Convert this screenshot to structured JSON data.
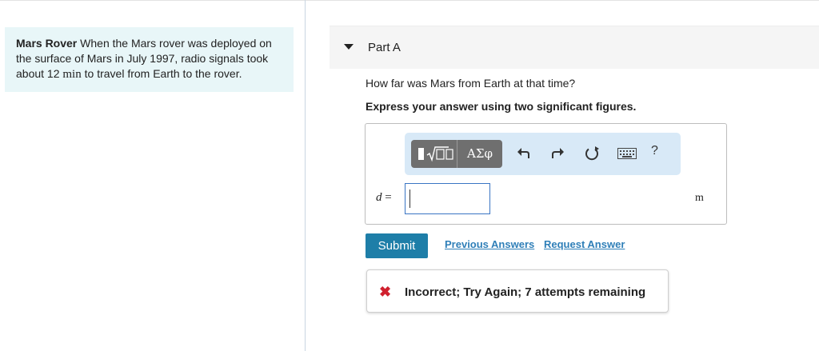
{
  "problem": {
    "title": "Mars Rover",
    "text_before": " When the Mars rover was deployed on the surface of Mars in July 1997, radio signals took about 12 ",
    "unit_inline": "min",
    "text_after": " to travel from Earth to the rover."
  },
  "part": {
    "title": "Part A",
    "question": "How far was Mars from Earth at that time?",
    "instruction": "Express your answer using two significant figures."
  },
  "toolbar": {
    "templates_icon": "templates-icon",
    "greek_label": "ΑΣφ",
    "undo_icon": "undo-icon",
    "redo_icon": "redo-icon",
    "reset_icon": "reset-icon",
    "keyboard_icon": "keyboard-icon",
    "help_label": "?"
  },
  "answer": {
    "variable": "d",
    "equals": " =",
    "value": "",
    "unit": "m"
  },
  "actions": {
    "submit_label": "Submit",
    "previous_answers_label": "Previous Answers",
    "request_answer_label": "Request Answer"
  },
  "feedback": {
    "icon": "incorrect-x-icon",
    "message": "Incorrect; Try Again; 7 attempts remaining"
  },
  "colors": {
    "problem_bg": "#e8f6f8",
    "toolbar_bg": "#d8e9f7",
    "submit_bg": "#1e7ea8",
    "link": "#2f7fb8",
    "error": "#d0202e"
  }
}
